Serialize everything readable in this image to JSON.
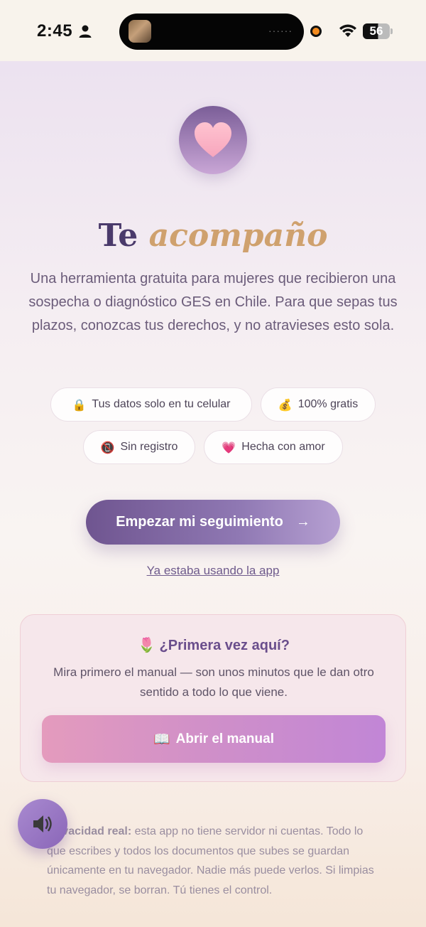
{
  "status_bar": {
    "time": "2:45",
    "battery": "56",
    "icons": [
      "person-icon",
      "app-thumbnail-icon",
      "recording-dot-icon",
      "wifi-icon",
      "battery-icon"
    ]
  },
  "hero": {
    "icon": "heart-icon",
    "title_plain": "Te",
    "title_accent": "acompaño",
    "subtitle": "Una herramienta gratuita para mujeres que recibieron una sospecha o diagnóstico GES en Chile. Para que sepas tus plazos, conozcas tus derechos, y no atravieses esto sola."
  },
  "chips": [
    {
      "emoji": "🔒",
      "label": "Tus datos solo en tu celular"
    },
    {
      "emoji": "💰",
      "label": "100% gratis"
    },
    {
      "emoji": "📵",
      "label": "Sin registro"
    },
    {
      "emoji": "💗",
      "label": "Hecha con amor"
    }
  ],
  "cta": {
    "label": "Empezar mi seguimiento",
    "arrow": "→"
  },
  "secondary_link": "Ya estaba usando la app",
  "first_time_card": {
    "emoji": "🌷",
    "title": "¿Primera vez aquí?",
    "text": "Mira primero el manual — son unos minutos que le dan otro sentido a todo lo que viene.",
    "button_emoji": "📖",
    "button_label": "Abrir el manual"
  },
  "privacy": {
    "bold": "Privacidad real:",
    "text": "esta app no tiene servidor ni cuentas. Todo lo que escribes y todos los documentos que subes se guardan únicamente en tu navegador. Nadie más puede verlos. Si limpias tu navegador, se borran. Tú tienes el control."
  },
  "sound_button": {
    "icon": "speaker-icon"
  },
  "colors": {
    "primary": "#6f5590",
    "accent": "#cfa16e",
    "title": "#4a3a6b",
    "manual_gradient_start": "#e49bbd",
    "manual_gradient_end": "#c186d6"
  }
}
